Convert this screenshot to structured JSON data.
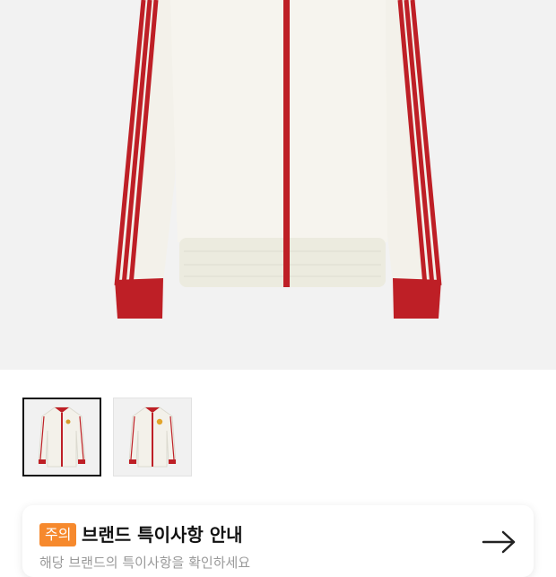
{
  "product": {
    "image_name": "white track jacket with red stripes",
    "colors": {
      "body": "#f3f1ea",
      "trim": "#be1f26",
      "background": "#f2f2f2"
    }
  },
  "thumbnails": [
    {
      "label": "front view",
      "selected": true
    },
    {
      "label": "front view with crest",
      "selected": false
    }
  ],
  "notice": {
    "badge": "주의",
    "title": "브랜드 특이사항 안내",
    "subtitle": "해당 브랜드의 특이사항을 확인하세요",
    "accent": "#f6892d"
  }
}
